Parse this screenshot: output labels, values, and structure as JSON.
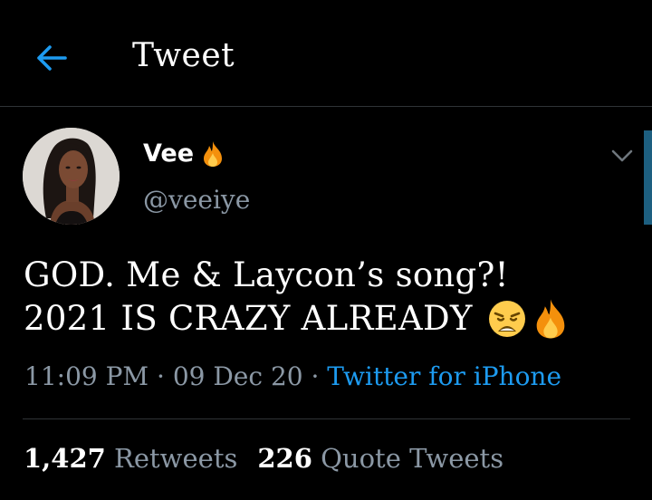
{
  "header": {
    "title": "Tweet"
  },
  "author": {
    "name": "Vee",
    "handle": "@veeiye"
  },
  "tweet": {
    "line1": "GOD. Me & Laycon’s song?!",
    "line2": "2021 IS CRAZY ALREADY"
  },
  "meta": {
    "time": "11:09 PM",
    "sep1": " · ",
    "date": "09 Dec 20",
    "sep2": " · ",
    "source": "Twitter for iPhone"
  },
  "stats": {
    "retweets": "1,427",
    "retweets_label": "Retweets",
    "quotes": "226",
    "quotes_label": "Quote Tweets"
  },
  "colors": {
    "background": "#000000",
    "accent": "#1d9bf0",
    "muted": "#8b98a5",
    "divider": "#2f3336"
  },
  "icons": {
    "back": "arrow-left-icon",
    "name_emoji": "fire-icon",
    "menu": "chevron-down-icon",
    "text_emojis": [
      "weary-face-icon",
      "fire-icon"
    ]
  }
}
